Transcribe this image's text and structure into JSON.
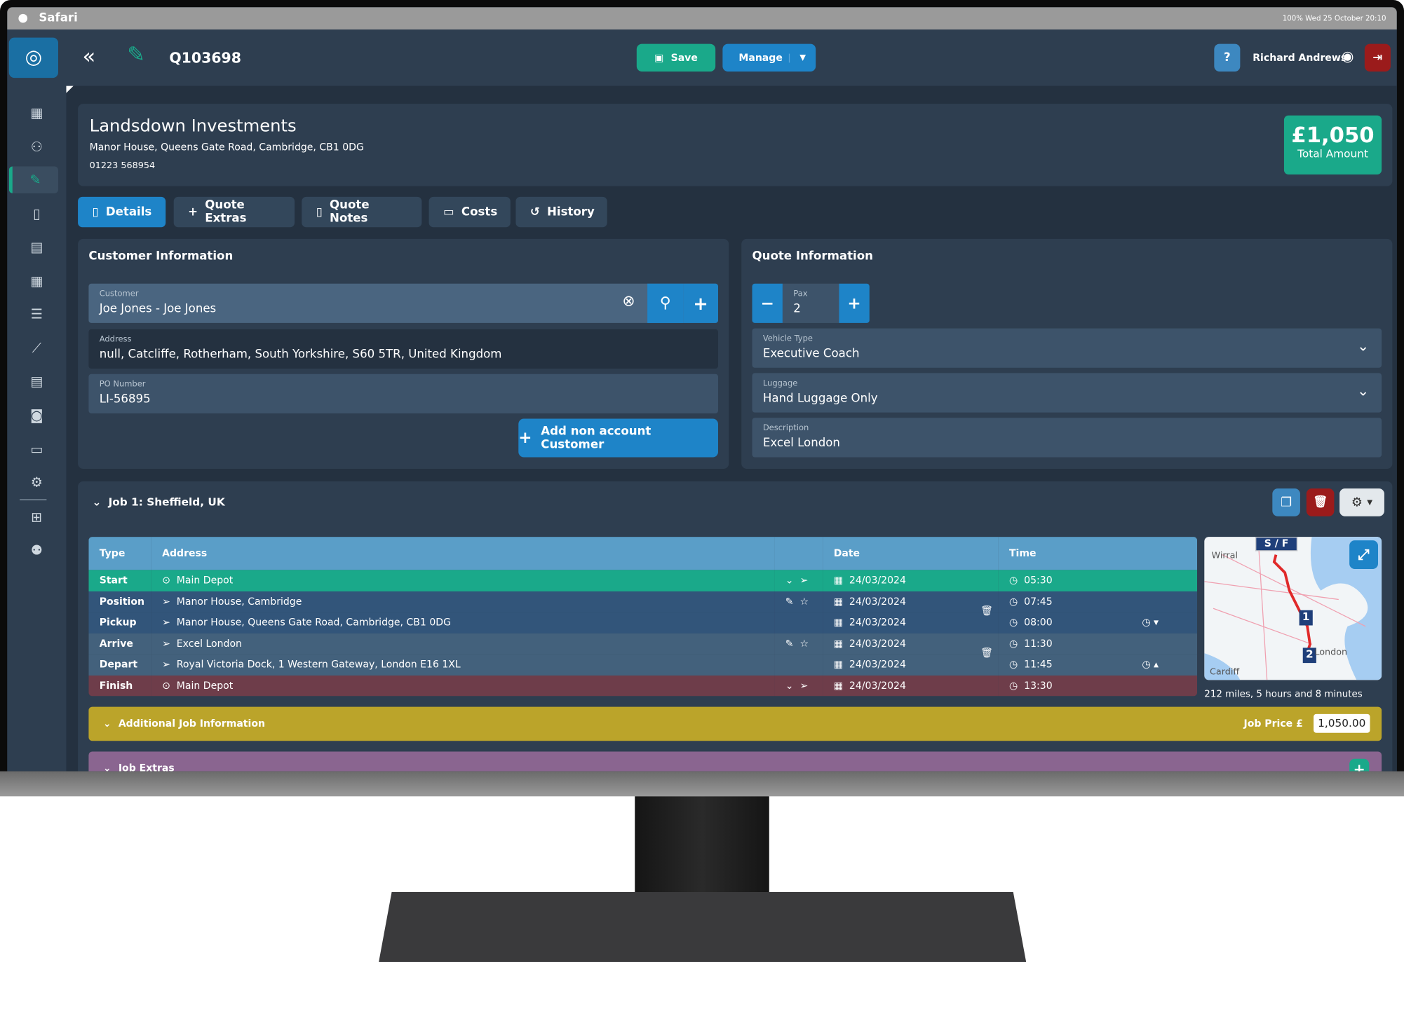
{
  "os_bar": {
    "app": "Safari",
    "status": "100%  Wed 25 October 20:10"
  },
  "header": {
    "quote_id": "Q103698",
    "save": "Save",
    "manage": "Manage",
    "user": "Richard Andrews"
  },
  "sidebar": {
    "items": [
      "dashboard-icon",
      "users-icon",
      "quotes-icon",
      "bookings-icon",
      "invoices-icon",
      "calendar-icon",
      "tasks-icon",
      "reports-icon",
      "documents-icon",
      "payments-icon",
      "archive-icon",
      "settings-icon",
      "add-document-icon",
      "add-user-icon"
    ],
    "active": 2
  },
  "company": {
    "name": "Landsdown Investments",
    "address": "Manor House, Queens Gate Road, Cambridge, CB1 0DG",
    "phone": "01223 568954",
    "total": "£1,050",
    "total_label": "Total Amount"
  },
  "tabs": [
    {
      "label": "Details",
      "active": true
    },
    {
      "label": "Quote Extras"
    },
    {
      "label": "Quote Notes"
    },
    {
      "label": "Costs"
    },
    {
      "label": "History"
    }
  ],
  "customer_info": {
    "title": "Customer Information",
    "customer": {
      "label": "Customer",
      "value": "Joe Jones - Joe Jones"
    },
    "address": {
      "label": "Address",
      "value": "null, Catcliffe, Rotherham, South Yorkshire, S60 5TR, United Kingdom"
    },
    "po": {
      "label": "PO Number",
      "value": "LI-56895"
    },
    "add_button": "Add non account Customer"
  },
  "quote_info": {
    "title": "Quote Information",
    "pax": {
      "label": "Pax",
      "value": "2"
    },
    "vehicle": {
      "label": "Vehicle Type",
      "value": "Executive Coach"
    },
    "luggage": {
      "label": "Luggage",
      "value": "Hand Luggage Only"
    },
    "description": {
      "label": "Description",
      "value": "Excel London"
    }
  },
  "job": {
    "title": "Job 1: Sheffield, UK",
    "columns": [
      "Type",
      "Address",
      "Date",
      "Time"
    ],
    "rows": [
      {
        "type": "Start",
        "address": "Main Depot",
        "date": "24/03/2024",
        "time": "05:30",
        "color": "#1aa98a"
      },
      {
        "type": "Position",
        "address": "Manor House, Cambridge",
        "date": "24/03/2024",
        "time": "07:45",
        "color": "#32557a"
      },
      {
        "type": "Pickup",
        "address": "Manor House, Queens Gate Road, Cambridge, CB1 0DG",
        "date": "24/03/2024",
        "time": "08:00",
        "color": "#32557a"
      },
      {
        "type": "Arrive",
        "address": "Excel London",
        "date": "24/03/2024",
        "time": "11:30",
        "color": "#43617c"
      },
      {
        "type": "Depart",
        "address": "Royal Victoria Dock, 1 Western Gateway, London E16 1XL",
        "date": "24/03/2024",
        "time": "11:45",
        "color": "#43617c"
      },
      {
        "type": "Finish",
        "address": "Main Depot",
        "date": "24/03/2024",
        "time": "13:30",
        "color": "#6e3d4a"
      }
    ],
    "map": {
      "labels": [
        "S / F",
        "1",
        "2",
        "Wirral",
        "London",
        "Cardiff"
      ]
    },
    "route_summary": "212 miles, 5 hours and 8 minutes",
    "additional": "Additional Job Information",
    "job_price_label": "Job Price  £",
    "job_price": "1,050.00",
    "extras": "Job Extras"
  },
  "colors": {
    "accent": "#1aa98a",
    "primary": "#1e84c8",
    "danger": "#9b1b1b",
    "additional": "#bba42a",
    "extras": "#8a6590"
  }
}
